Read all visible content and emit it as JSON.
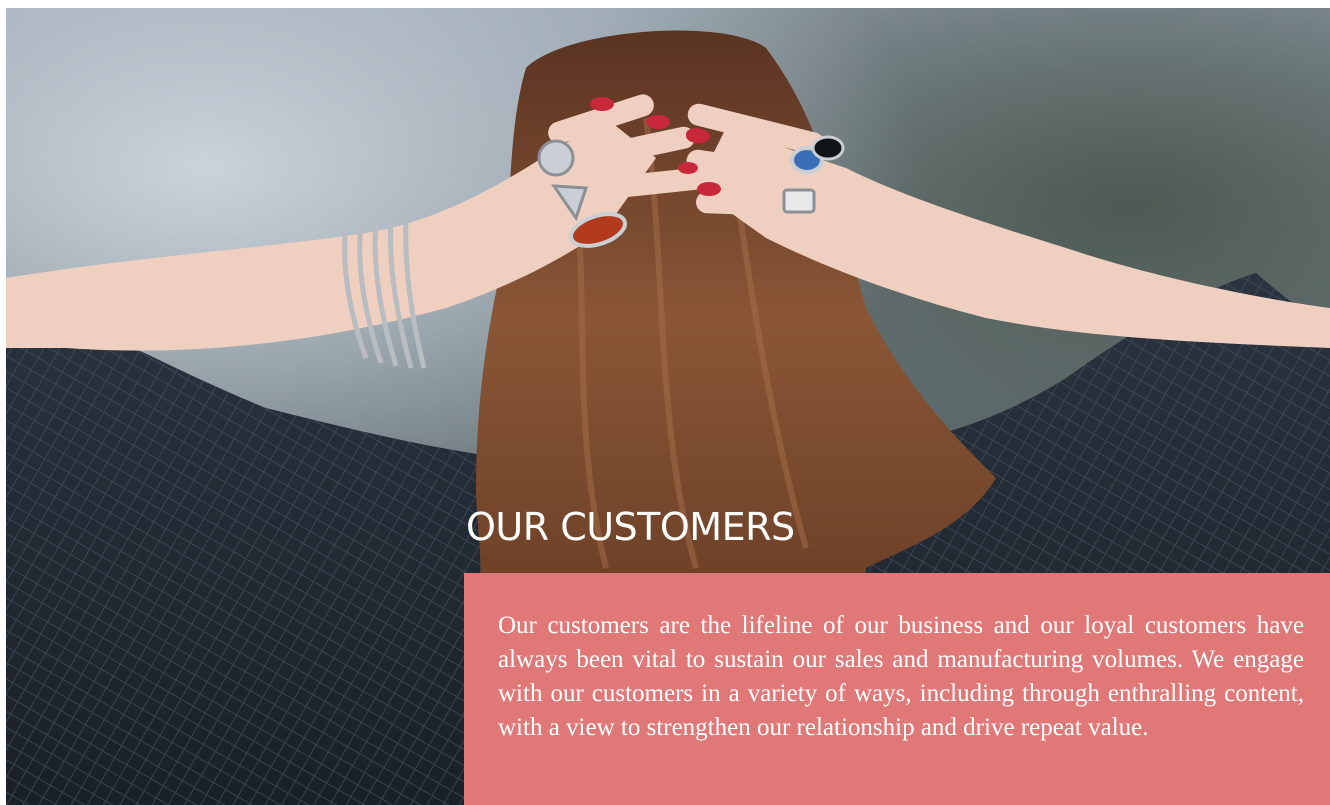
{
  "section": {
    "title": "OUR CUSTOMERS",
    "body": "Our customers are the lifeline of our business and our loyal customers have always been vital to sustain our sales and manufacturing volumes. We engage with our customers in a variety of ways, including through enthralling content, with a view to strengthen our relationship and drive repeat value."
  },
  "colors": {
    "panel": "#e07878",
    "title_text": "#ffffff",
    "body_text": "#ffffff"
  }
}
